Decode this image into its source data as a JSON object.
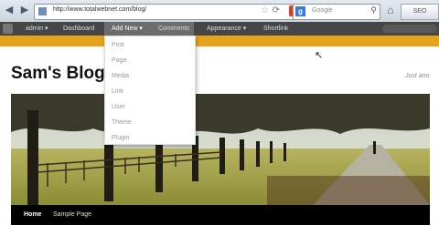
{
  "browser": {
    "url": "http://www.totalwebnet.com/blog/",
    "search_placeholder": "Google",
    "search_engine_letter": "g",
    "extension_label": "SEO"
  },
  "adminbar": {
    "items": [
      {
        "label": "admin ▾"
      },
      {
        "label": "Dashboard"
      },
      {
        "label": "Add New ▾"
      },
      {
        "label": "Comments"
      },
      {
        "label": "Appearance ▾"
      },
      {
        "label": "Shortlink"
      }
    ]
  },
  "add_new_menu": {
    "items": [
      "Post",
      "Page",
      "Media",
      "Link",
      "User",
      "Theme",
      "Plugin"
    ]
  },
  "blog": {
    "title": "Sam's Blog",
    "tagline": "Just ano"
  },
  "blog_nav": {
    "items": [
      "Home",
      "Sample Page"
    ]
  },
  "colors": {
    "admin_bar": "#464646",
    "accent_band": "#e6a21a",
    "nav_bar": "#000000"
  }
}
